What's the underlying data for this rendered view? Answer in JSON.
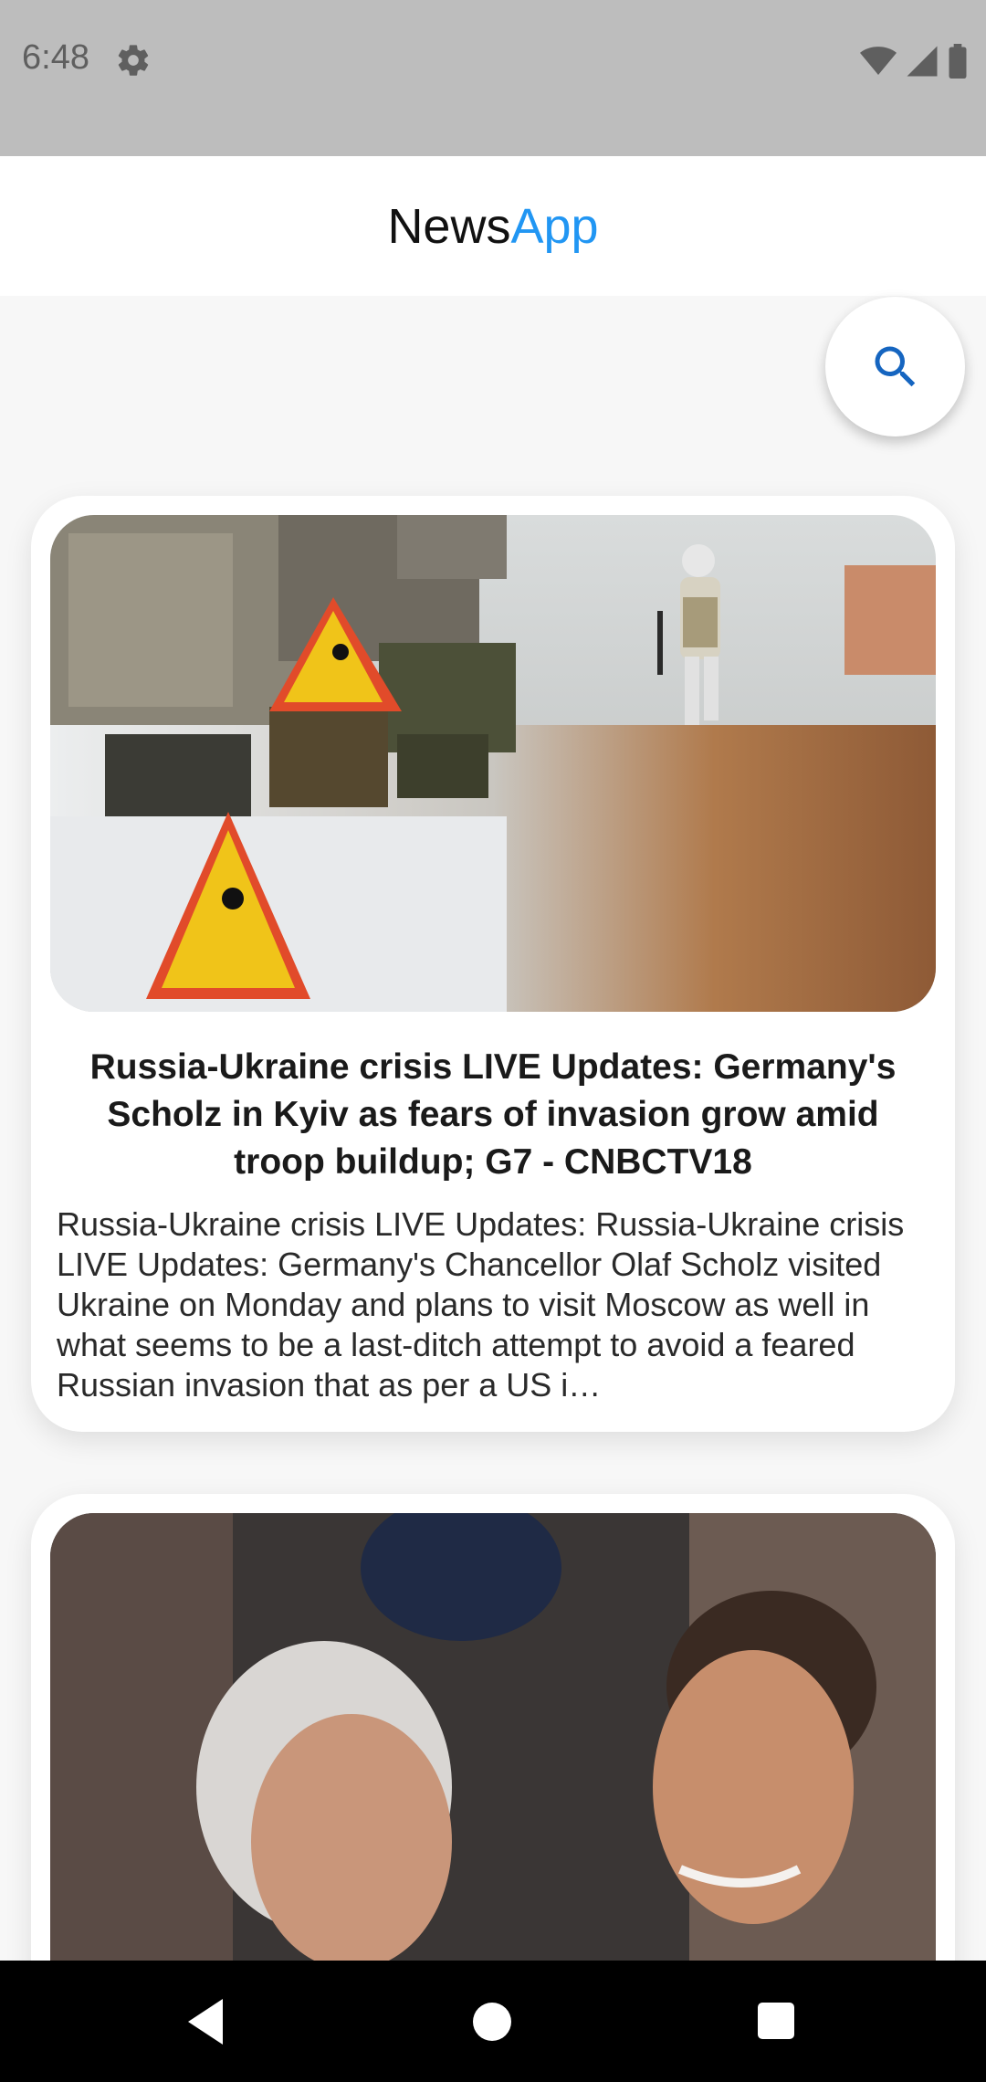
{
  "status_bar": {
    "time": "6:48",
    "icons": [
      "gear-icon",
      "wifi-icon",
      "signal-icon",
      "battery-icon"
    ]
  },
  "app_bar": {
    "title_part1": "News",
    "title_part2": "App",
    "accent_color": "#2196f3"
  },
  "search_button": {
    "icon": "search-icon",
    "color": "#1565c0"
  },
  "articles": [
    {
      "image": "war-scene-photo",
      "title": "Russia-Ukraine crisis LIVE Updates: Germany's Scholz in Kyiv as fears of invasion grow amid troop buildup; G7 - CNBCTV18",
      "description": "Russia-Ukraine crisis LIVE Updates: Russia-Ukraine crisis LIVE Updates: Germany's Chancellor Olaf Scholz visited Ukraine on Monday and plans to visit Moscow as well in what seems to be a last-ditch attempt to avoid a feared Russian invasion that as per a US i…"
    },
    {
      "image": "politicians-greeting-photo"
    }
  ],
  "nav_bar": {
    "buttons": [
      "back-button",
      "home-button",
      "recents-button"
    ]
  }
}
